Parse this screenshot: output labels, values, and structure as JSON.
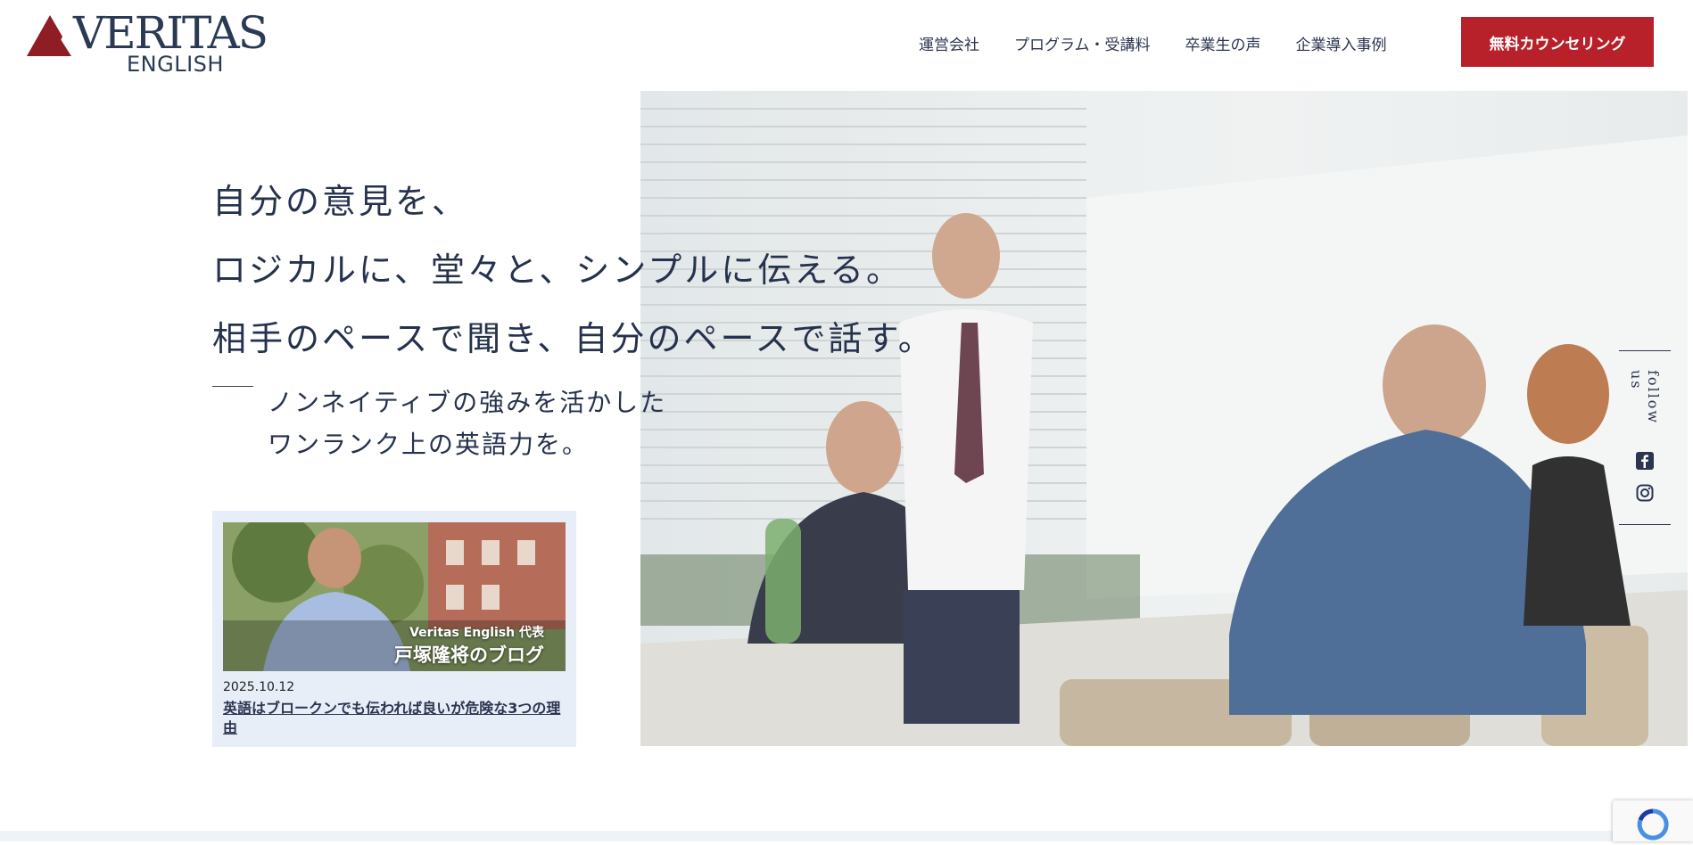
{
  "logo": {
    "name": "VERITAS",
    "sub": "ENGLISH"
  },
  "nav": {
    "items": [
      {
        "label": "運営会社"
      },
      {
        "label": "プログラム・受講料"
      },
      {
        "label": "卒業生の声"
      },
      {
        "label": "企業導入事例"
      }
    ],
    "cta": "無料カウンセリング"
  },
  "hero": {
    "headline": [
      "自分の意見を、",
      "ロジカルに、堂々と、シンプルに伝える。",
      "相手のペースで聞き、自分のペースで話す。"
    ],
    "subhead": [
      "ノンネイティブの強みを活かした",
      "ワンランク上の英語力を。"
    ]
  },
  "blog": {
    "caption_small": "Veritas English 代表",
    "caption_big": "戸塚隆将のブログ",
    "date": "2025.10.12",
    "title": "英語はブロークンでも伝われば良いが危険な3つの理由"
  },
  "follow": {
    "label": "follow us",
    "icons": [
      "facebook-icon",
      "instagram-icon"
    ]
  },
  "colors": {
    "brand_red": "#b8202a",
    "navy": "#26324d",
    "card_bg": "#e7eef7"
  }
}
